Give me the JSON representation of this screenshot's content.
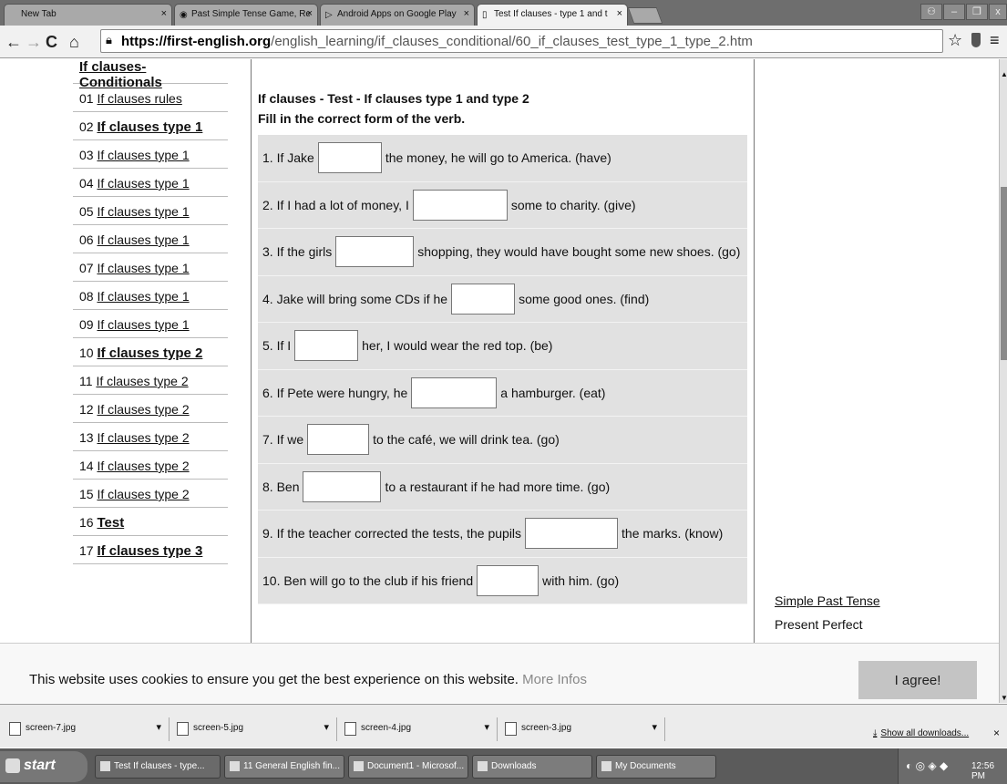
{
  "browser": {
    "tabs": [
      {
        "label": "New Tab",
        "icon": "blank-page-icon"
      },
      {
        "label": "Past Simple Tense Game, Re",
        "icon": "site-favicon-icon"
      },
      {
        "label": "Android Apps on Google Play",
        "icon": "play-store-icon"
      },
      {
        "label": "Test If clauses - type 1 and t",
        "icon": "page-icon"
      }
    ],
    "url_host": "https://first-english.org",
    "url_path": "/english_learning/if_clauses_conditional/60_if_clauses_test_type_1_type_2.htm"
  },
  "sidebar": {
    "heading": "If clauses-Conditionals",
    "items": [
      {
        "num": "01",
        "label": "If clauses rules"
      },
      {
        "num": "02",
        "label": "If clauses type 1"
      },
      {
        "num": "03",
        "label": "If clauses type 1"
      },
      {
        "num": "04",
        "label": "If clauses type 1"
      },
      {
        "num": "05",
        "label": "If clauses type 1"
      },
      {
        "num": "06",
        "label": "If clauses type 1"
      },
      {
        "num": "07",
        "label": "If clauses type 1"
      },
      {
        "num": "08",
        "label": "If clauses type 1"
      },
      {
        "num": "09",
        "label": "If clauses type 1"
      },
      {
        "num": "10",
        "label": "If clauses type 2"
      },
      {
        "num": "11",
        "label": "If clauses type 2"
      },
      {
        "num": "12",
        "label": "If clauses type 2"
      },
      {
        "num": "13",
        "label": "If clauses type 2"
      },
      {
        "num": "14",
        "label": "If clauses type 2"
      },
      {
        "num": "15",
        "label": "If clauses type 2"
      },
      {
        "num": "16",
        "label": "Test"
      },
      {
        "num": "17",
        "label": "If clauses type 3"
      }
    ]
  },
  "main": {
    "title": "If clauses - Test - If clauses type 1 and type 2",
    "instruction": "Fill in the correct form of the verb.",
    "questions": [
      {
        "before": "1. If Jake",
        "after": "the money, he will go to America. (have)",
        "value": ""
      },
      {
        "before": "2. If I had a lot of money, I",
        "after": "some to charity. (give)",
        "value": ""
      },
      {
        "before": "3. If the girls",
        "after": "shopping, they would have bought some new shoes. (go)",
        "value": ""
      },
      {
        "before": "4. Jake will bring some CDs if he",
        "after": "some good ones. (find)",
        "value": ""
      },
      {
        "before": "5. If I",
        "after": "her, I would wear the red top. (be)",
        "value": ""
      },
      {
        "before": "6. If Pete were hungry, he",
        "after": "a hamburger. (eat)",
        "value": ""
      },
      {
        "before": "7. If we",
        "after": "to the café, we will drink tea. (go)",
        "value": ""
      },
      {
        "before": "8. Ben",
        "after": "to a restaurant if he had more time. (go)",
        "value": ""
      },
      {
        "before": "9. If the teacher corrected the tests, the pupils",
        "after": "the marks. (know)",
        "value": ""
      },
      {
        "before": "10. Ben will go to the club if his friend",
        "after": "with him. (go)",
        "value": ""
      }
    ]
  },
  "right_links": {
    "link1": "Simple Past Tense",
    "link2": "Present Perfect"
  },
  "cookie": {
    "message": "This website uses cookies to ensure you get the best experience on this website.",
    "more": "More Infos",
    "agree": "I agree!"
  },
  "downloads": {
    "items": [
      "screen-7.jpg",
      "screen-5.jpg",
      "screen-4.jpg",
      "screen-3.jpg"
    ],
    "show_all": "Show all downloads..."
  },
  "taskbar": {
    "start": "start",
    "tasks": [
      "Test If clauses - type...",
      "11 General English fin...",
      "Document1 - Microsof...",
      "Downloads",
      "My Documents"
    ],
    "clock": "12:56 PM"
  }
}
